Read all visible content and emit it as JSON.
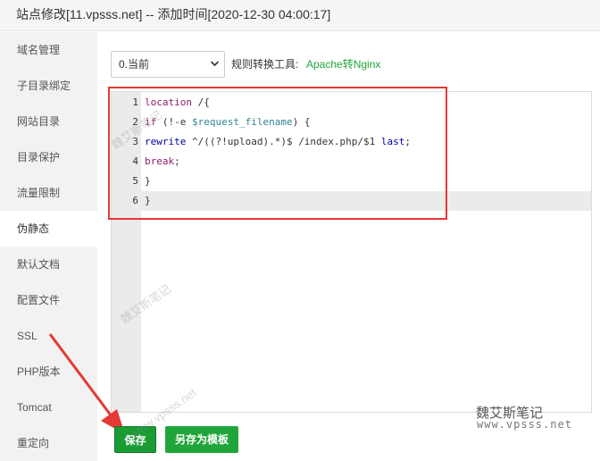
{
  "window": {
    "title": "站点修改[11.vpsss.net] -- 添加时间[2020-12-30 04:00:17]"
  },
  "sidebar": {
    "items": [
      {
        "label": "域名管理"
      },
      {
        "label": "子目录绑定"
      },
      {
        "label": "网站目录"
      },
      {
        "label": "目录保护"
      },
      {
        "label": "流量限制"
      },
      {
        "label": "伪静态"
      },
      {
        "label": "默认文档"
      },
      {
        "label": "配置文件"
      },
      {
        "label": "SSL"
      },
      {
        "label": "PHP版本"
      },
      {
        "label": "Tomcat"
      },
      {
        "label": "重定向"
      }
    ],
    "active_index": 5
  },
  "toolbar": {
    "version_select": "0.当前",
    "rule_tool_label": "规则转换工具:",
    "rule_tool_link": "Apache转Nginx"
  },
  "editor": {
    "line_numbers": [
      "1",
      "2",
      "3",
      "4",
      "5",
      "6"
    ],
    "lines": [
      "location /{",
      "if (!-e $request_filename) {",
      "rewrite ^/((?!upload).*)$ /index.php/$1 last;",
      "break;",
      "}",
      "}"
    ],
    "active_line": 6
  },
  "buttons": {
    "save": "保存",
    "save_as_template": "另存为模板"
  },
  "watermark": {
    "brand": "魏艾斯笔记",
    "url": "www.vpsss.net"
  },
  "colors": {
    "accent": "#20a53a",
    "annotation": "#e53935"
  }
}
